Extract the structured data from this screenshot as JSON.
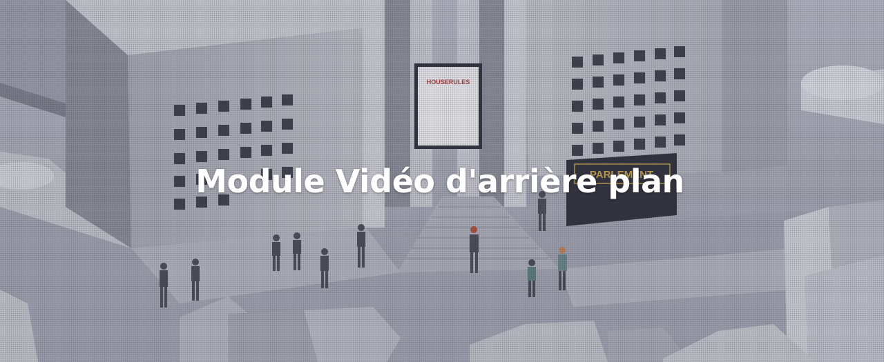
{
  "hero": {
    "title": "Module Vidéo d'arrière plan",
    "background_description_icon": "video-background-scene"
  },
  "scene": {
    "poster_sign": "HOUSERULES",
    "banner_sign": "PARLEMENT"
  },
  "colors": {
    "title_text": "#ffffff",
    "overlay_tint": "#46485f",
    "poster_accent": "#b03a3a",
    "banner_accent": "#c9a64a"
  }
}
